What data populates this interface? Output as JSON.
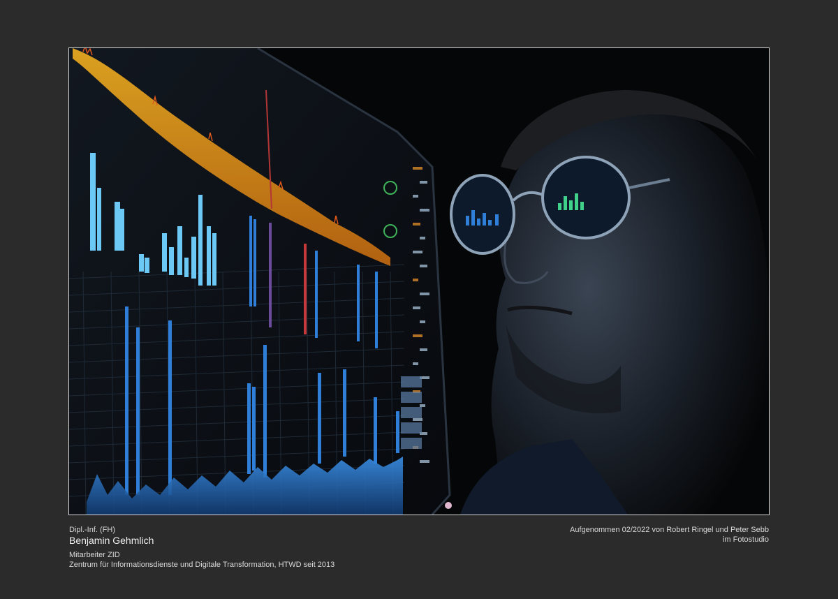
{
  "photo": {
    "subject": "",
    "colors": {
      "background": "#2b2b2b",
      "frame_border": "#d8d8d8",
      "screen_blue": "#2f7fd8",
      "screen_light_blue": "#6cc8f5",
      "accent_orange": "#e08a1e",
      "accent_red": "#d23a3a"
    }
  },
  "caption": {
    "title": "Dipl.-Inf. (FH)",
    "name": "Benjamin Gehmlich",
    "role": "Mitarbeiter ZID",
    "department": "Zentrum für Informationsdienste und Digitale Transformation, HTWD seit 2013",
    "credit_line1": "Aufgenommen 02/2022 von Robert Ringel und Peter Sebb",
    "credit_line2": "im Fotostudio"
  }
}
